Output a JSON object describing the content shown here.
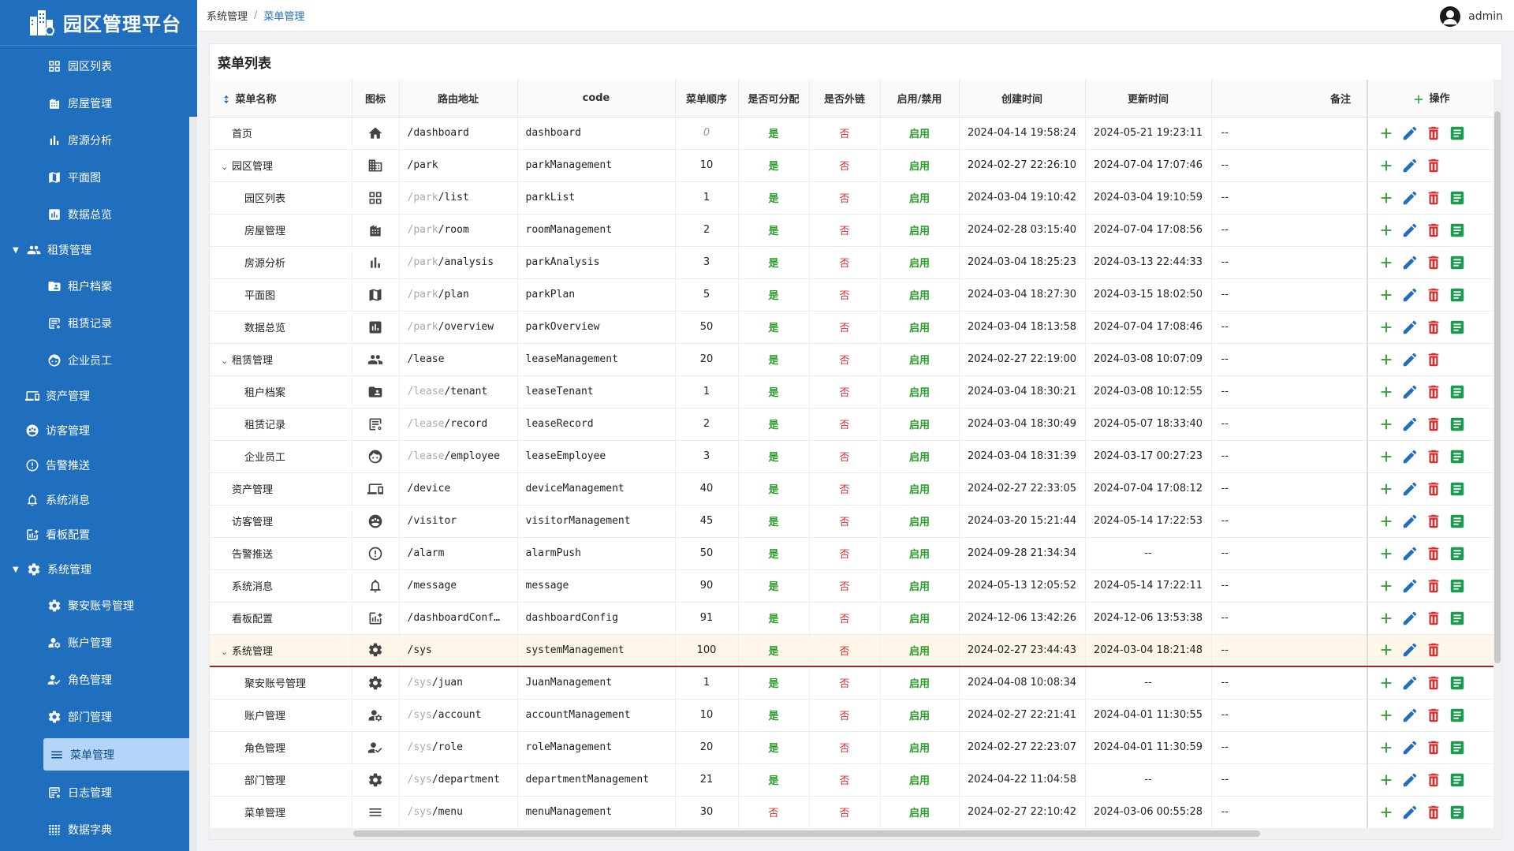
{
  "app": {
    "title": "园区管理平台"
  },
  "breadcrumb": {
    "parent": "系统管理",
    "sep": "/",
    "current": "菜单管理"
  },
  "user": {
    "name": "admin"
  },
  "sidebar": {
    "items": [
      {
        "label": "园区列表",
        "level": "l2",
        "icon": "grid-icon"
      },
      {
        "label": "房屋管理",
        "level": "l2",
        "icon": "building-icon"
      },
      {
        "label": "房源分析",
        "level": "l2",
        "icon": "bar-chart-icon"
      },
      {
        "label": "平面图",
        "level": "l2",
        "icon": "map-icon"
      },
      {
        "label": "数据总览",
        "level": "l2",
        "icon": "chart-box-icon"
      },
      {
        "label": "租赁管理",
        "level": "parent",
        "icon": "people-icon"
      },
      {
        "label": "租户档案",
        "level": "l2",
        "icon": "folder-user-icon"
      },
      {
        "label": "租赁记录",
        "level": "l2",
        "icon": "record-icon"
      },
      {
        "label": "企业员工",
        "level": "l2",
        "icon": "face-icon"
      },
      {
        "label": "资产管理",
        "level": "l1",
        "icon": "device-icon"
      },
      {
        "label": "访客管理",
        "level": "l1",
        "icon": "visitor-icon"
      },
      {
        "label": "告警推送",
        "level": "l1",
        "icon": "alert-icon"
      },
      {
        "label": "系统消息",
        "level": "l1",
        "icon": "bell-icon"
      },
      {
        "label": "看板配置",
        "level": "l1",
        "icon": "dashboard-config-icon"
      },
      {
        "label": "系统管理",
        "level": "parent",
        "icon": "gear-icon"
      },
      {
        "label": "聚安账号管理",
        "level": "l2",
        "icon": "gear-icon"
      },
      {
        "label": "账户管理",
        "level": "l2",
        "icon": "user-gear-icon"
      },
      {
        "label": "角色管理",
        "level": "l2",
        "icon": "user-check-icon"
      },
      {
        "label": "部门管理",
        "level": "l2",
        "icon": "gear-icon"
      },
      {
        "label": "菜单管理",
        "level": "active",
        "icon": "menu-icon"
      },
      {
        "label": "日志管理",
        "level": "l2",
        "icon": "record-icon"
      },
      {
        "label": "数据字典",
        "level": "l2",
        "icon": "dict-icon"
      }
    ]
  },
  "card": {
    "title": "菜单列表"
  },
  "table": {
    "headers": [
      "菜单名称",
      "图标",
      "路由地址",
      "code",
      "菜单顺序",
      "是否可分配",
      "是否外链",
      "启用/禁用",
      "创建时间",
      "更新时间",
      "备注",
      "操作"
    ],
    "rows": [
      {
        "name": "首页",
        "kind": "root",
        "icon": "home-icon",
        "pre": "",
        "path": "/dashboard",
        "code": "dashboard",
        "order": "0",
        "assign": "是",
        "ext": "否",
        "status": "启用",
        "created": "2024-04-14 19:58:24",
        "updated": "2024-05-21 19:23:11",
        "note": "--",
        "detail": true
      },
      {
        "name": "园区管理",
        "kind": "toggle",
        "icon": "building-list-icon",
        "pre": "",
        "path": "/park",
        "code": "parkManagement",
        "order": "10",
        "assign": "是",
        "ext": "否",
        "status": "启用",
        "created": "2024-02-27 22:26:10",
        "updated": "2024-07-04 17:07:46",
        "note": "--",
        "detail": false
      },
      {
        "name": "园区列表",
        "kind": "child",
        "icon": "grid-icon",
        "pre": "/park",
        "path": "/list",
        "code": "parkList",
        "order": "1",
        "assign": "是",
        "ext": "否",
        "status": "启用",
        "created": "2024-03-04 19:10:42",
        "updated": "2024-03-04 19:10:59",
        "note": "--",
        "detail": true
      },
      {
        "name": "房屋管理",
        "kind": "child",
        "icon": "building-icon",
        "pre": "/park",
        "path": "/room",
        "code": "roomManagement",
        "order": "2",
        "assign": "是",
        "ext": "否",
        "status": "启用",
        "created": "2024-02-28 03:15:40",
        "updated": "2024-07-04 17:08:56",
        "note": "--",
        "detail": true
      },
      {
        "name": "房源分析",
        "kind": "child",
        "icon": "bar-chart-icon",
        "pre": "/park",
        "path": "/analysis",
        "code": "parkAnalysis",
        "order": "3",
        "assign": "是",
        "ext": "否",
        "status": "启用",
        "created": "2024-03-04 18:25:23",
        "updated": "2024-03-13 22:44:33",
        "note": "--",
        "detail": true
      },
      {
        "name": "平面图",
        "kind": "child",
        "icon": "map-icon",
        "pre": "/park",
        "path": "/plan",
        "code": "parkPlan",
        "order": "5",
        "assign": "是",
        "ext": "否",
        "status": "启用",
        "created": "2024-03-04 18:27:30",
        "updated": "2024-03-15 18:02:50",
        "note": "--",
        "detail": true
      },
      {
        "name": "数据总览",
        "kind": "child",
        "icon": "chart-box-icon",
        "pre": "/park",
        "path": "/overview",
        "code": "parkOverview",
        "order": "50",
        "assign": "是",
        "ext": "否",
        "status": "启用",
        "created": "2024-03-04 18:13:58",
        "updated": "2024-07-04 17:08:46",
        "note": "--",
        "detail": true
      },
      {
        "name": "租赁管理",
        "kind": "toggle",
        "icon": "people-icon",
        "pre": "",
        "path": "/lease",
        "code": "leaseManagement",
        "order": "20",
        "assign": "是",
        "ext": "否",
        "status": "启用",
        "created": "2024-02-27 22:19:00",
        "updated": "2024-03-08 10:07:09",
        "note": "--",
        "detail": false
      },
      {
        "name": "租户档案",
        "kind": "child",
        "icon": "folder-user-icon",
        "pre": "/lease",
        "path": "/tenant",
        "code": "leaseTenant",
        "order": "1",
        "assign": "是",
        "ext": "否",
        "status": "启用",
        "created": "2024-03-04 18:30:21",
        "updated": "2024-03-08 10:12:55",
        "note": "--",
        "detail": true
      },
      {
        "name": "租赁记录",
        "kind": "child",
        "icon": "record-icon",
        "pre": "/lease",
        "path": "/record",
        "code": "leaseRecord",
        "order": "2",
        "assign": "是",
        "ext": "否",
        "status": "启用",
        "created": "2024-03-04 18:30:49",
        "updated": "2024-05-07 18:33:40",
        "note": "--",
        "detail": true
      },
      {
        "name": "企业员工",
        "kind": "child",
        "icon": "face-icon",
        "pre": "/lease",
        "path": "/employee",
        "code": "leaseEmployee",
        "order": "3",
        "assign": "是",
        "ext": "否",
        "status": "启用",
        "created": "2024-03-04 18:31:39",
        "updated": "2024-03-17 00:27:23",
        "note": "--",
        "detail": true
      },
      {
        "name": "资产管理",
        "kind": "root",
        "icon": "device-icon",
        "pre": "",
        "path": "/device",
        "code": "deviceManagement",
        "order": "40",
        "assign": "是",
        "ext": "否",
        "status": "启用",
        "created": "2024-02-27 22:33:05",
        "updated": "2024-07-04 17:08:12",
        "note": "--",
        "detail": true
      },
      {
        "name": "访客管理",
        "kind": "root",
        "icon": "visitor-icon",
        "pre": "",
        "path": "/visitor",
        "code": "visitorManagement",
        "order": "45",
        "assign": "是",
        "ext": "否",
        "status": "启用",
        "created": "2024-03-20 15:21:44",
        "updated": "2024-05-14 17:22:53",
        "note": "--",
        "detail": true
      },
      {
        "name": "告警推送",
        "kind": "root",
        "icon": "alert-icon",
        "pre": "",
        "path": "/alarm",
        "code": "alarmPush",
        "order": "50",
        "assign": "是",
        "ext": "否",
        "status": "启用",
        "created": "2024-09-28 21:34:34",
        "updated": "--",
        "note": "--",
        "detail": true
      },
      {
        "name": "系统消息",
        "kind": "root",
        "icon": "bell-icon",
        "pre": "",
        "path": "/message",
        "code": "message",
        "order": "90",
        "assign": "是",
        "ext": "否",
        "status": "启用",
        "created": "2024-05-13 12:05:52",
        "updated": "2024-05-14 17:22:11",
        "note": "--",
        "detail": true
      },
      {
        "name": "看板配置",
        "kind": "root",
        "icon": "dashboard-config-icon",
        "pre": "",
        "path": "/dashboardConf…",
        "code": "dashboardConfig",
        "order": "91",
        "assign": "是",
        "ext": "否",
        "status": "启用",
        "created": "2024-12-06 13:42:26",
        "updated": "2024-12-06 13:53:38",
        "note": "--",
        "detail": true
      },
      {
        "name": "系统管理",
        "kind": "toggle",
        "icon": "gear-icon",
        "pre": "",
        "path": "/sys",
        "code": "systemManagement",
        "order": "100",
        "assign": "是",
        "ext": "否",
        "status": "启用",
        "created": "2024-02-27 23:44:43",
        "updated": "2024-03-04 18:21:48",
        "note": "--",
        "detail": false,
        "highlight": true
      },
      {
        "name": "聚安账号管理",
        "kind": "child",
        "icon": "gear-icon",
        "pre": "/sys",
        "path": "/juan",
        "code": "JuanManagement",
        "order": "1",
        "assign": "是",
        "ext": "否",
        "status": "启用",
        "created": "2024-04-08 10:08:34",
        "updated": "--",
        "note": "--",
        "detail": true
      },
      {
        "name": "账户管理",
        "kind": "child",
        "icon": "user-gear-icon",
        "pre": "/sys",
        "path": "/account",
        "code": "accountManagement",
        "order": "10",
        "assign": "是",
        "ext": "否",
        "status": "启用",
        "created": "2024-02-27 22:21:41",
        "updated": "2024-04-01 11:30:55",
        "note": "--",
        "detail": true
      },
      {
        "name": "角色管理",
        "kind": "child",
        "icon": "user-check-icon",
        "pre": "/sys",
        "path": "/role",
        "code": "roleManagement",
        "order": "20",
        "assign": "是",
        "ext": "否",
        "status": "启用",
        "created": "2024-02-27 22:23:07",
        "updated": "2024-04-01 11:30:59",
        "note": "--",
        "detail": true
      },
      {
        "name": "部门管理",
        "kind": "child",
        "icon": "gear-icon",
        "pre": "/sys",
        "path": "/department",
        "code": "departmentManagement",
        "order": "21",
        "assign": "是",
        "ext": "否",
        "status": "启用",
        "created": "2024-04-22 11:04:58",
        "updated": "--",
        "note": "--",
        "detail": true
      },
      {
        "name": "菜单管理",
        "kind": "child",
        "icon": "menu-icon",
        "pre": "/sys",
        "path": "/menu",
        "code": "menuManagement",
        "order": "30",
        "assign": "否",
        "ext": "否",
        "status": "启用",
        "created": "2024-02-27 22:10:42",
        "updated": "2024-03-06 00:55:28",
        "note": "--",
        "detail": true
      }
    ]
  },
  "colors": {
    "sidebar": "#1f6fbe",
    "yes": "#2a9d2a",
    "no": "#d32f2f",
    "edit": "#1f6fbe",
    "delete": "#d32f2f",
    "add": "#2a9d2a",
    "highlight_row": "#fdf6e9"
  }
}
